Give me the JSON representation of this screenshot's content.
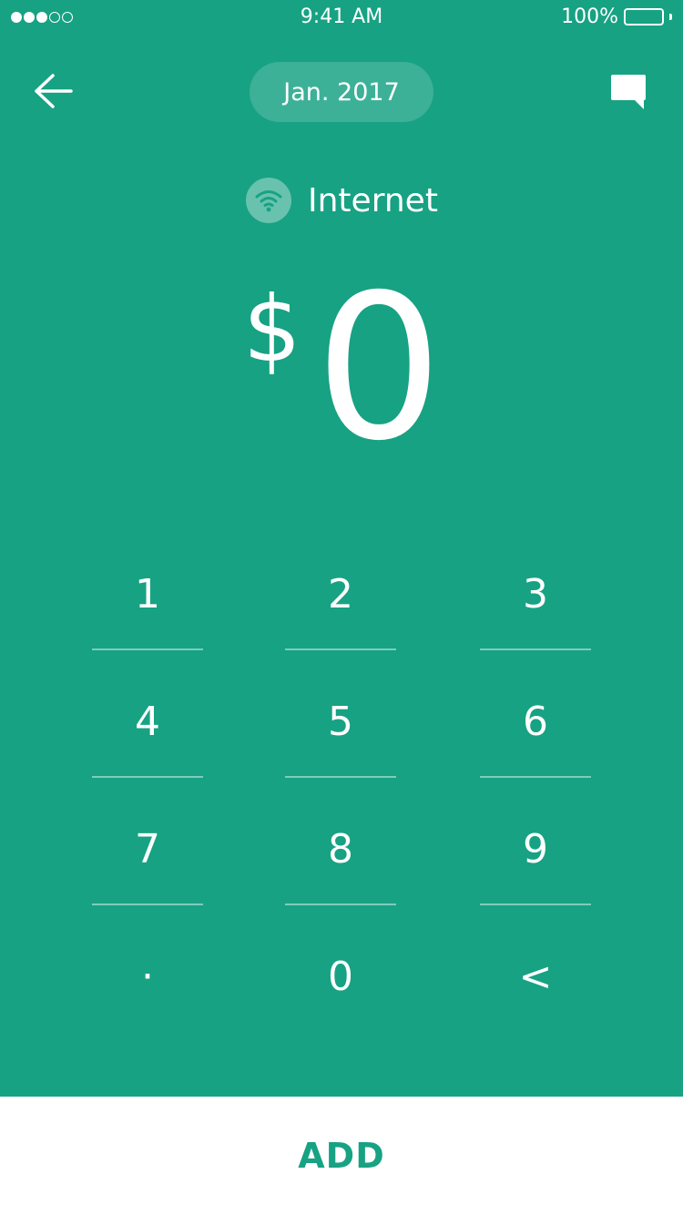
{
  "status_bar": {
    "time": "9:41 AM",
    "battery_percent": "100%",
    "signal_bars_filled": 3,
    "signal_bars_total": 5
  },
  "header": {
    "back_icon": "arrow-left-icon",
    "date_label": "Jan. 2017",
    "comment_icon": "speech-bubble-icon"
  },
  "category": {
    "icon": "wifi-icon",
    "label": "Internet"
  },
  "amount": {
    "currency": "$",
    "value": "0"
  },
  "keypad": {
    "keys": [
      "1",
      "2",
      "3",
      "4",
      "5",
      "6",
      "7",
      "8",
      "9",
      "·",
      "0",
      "<"
    ]
  },
  "footer": {
    "add_label": "ADD"
  },
  "colors": {
    "background": "#17a283",
    "button_bar": "#ffffff",
    "accent_text": "#17a283"
  }
}
